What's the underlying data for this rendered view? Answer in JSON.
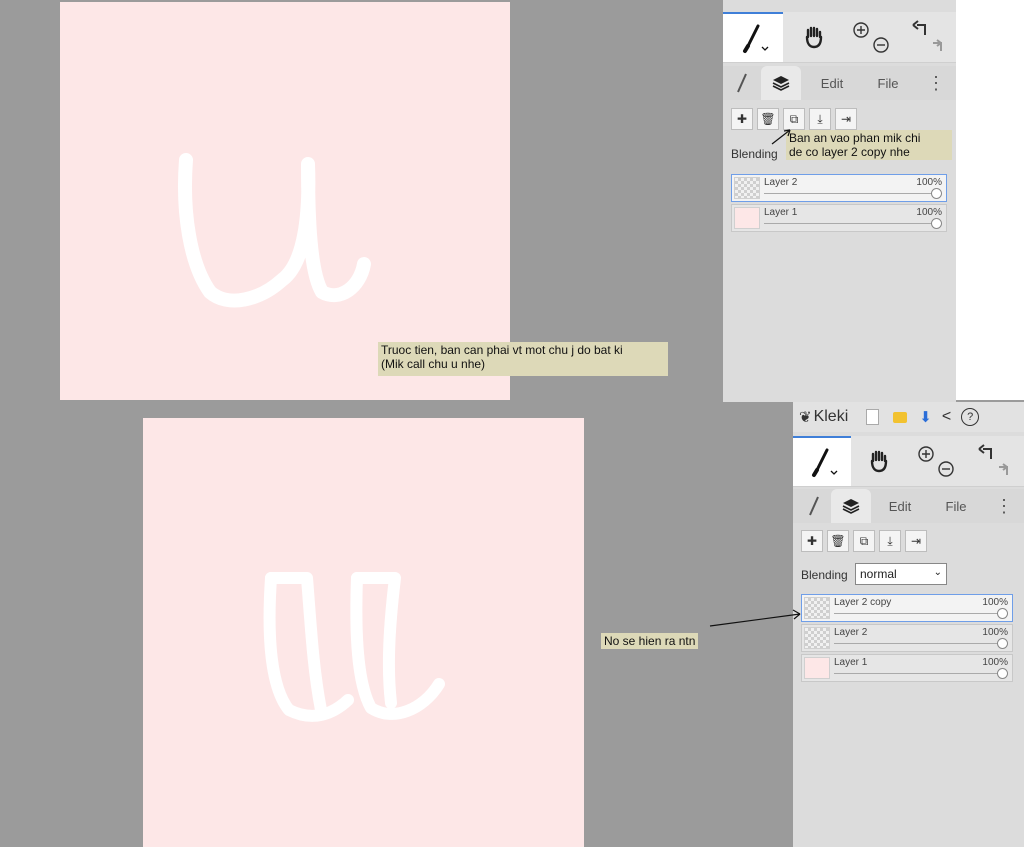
{
  "step1": {
    "tabs": {
      "edit": "Edit",
      "file": "File"
    },
    "blending_label": "Blending",
    "layers": [
      {
        "name": "Layer 2",
        "opacity": "100%"
      },
      {
        "name": "Layer 1",
        "opacity": "100%"
      }
    ],
    "note_main": [
      "Truoc tien, ban can phai vt mot chu j do bat ki",
      "(Mik call chu u nhe)"
    ],
    "note_tooltip": [
      "Ban an vao phan mik chi",
      "de co layer 2 copy nhe"
    ]
  },
  "step2": {
    "app_name": "Kleki",
    "tabs": {
      "edit": "Edit",
      "file": "File"
    },
    "blending_label": "Blending",
    "blending_value": "normal",
    "layers": [
      {
        "name": "Layer 2 copy",
        "opacity": "100%"
      },
      {
        "name": "Layer 2",
        "opacity": "100%"
      },
      {
        "name": "Layer 1",
        "opacity": "100%"
      }
    ],
    "note": "No se hien ra ntn"
  },
  "colors": {
    "canvas": "#fde7e7",
    "background": "#9b9b9b",
    "panel": "#dcdcdc",
    "stroke": "#ffffff",
    "accent": "#3f7fd8",
    "note": "#ddd9b8"
  },
  "icons": [
    "brush-icon",
    "hand-icon",
    "zoom-in-icon",
    "zoom-out-icon",
    "undo-icon",
    "redo-icon",
    "layers-icon",
    "add-layer-icon",
    "delete-layer-icon",
    "duplicate-layer-icon",
    "merge-icon",
    "move-layer-icon",
    "kleki-logo-icon",
    "new-file-icon",
    "folder-icon",
    "download-icon",
    "share-icon",
    "help-icon"
  ]
}
